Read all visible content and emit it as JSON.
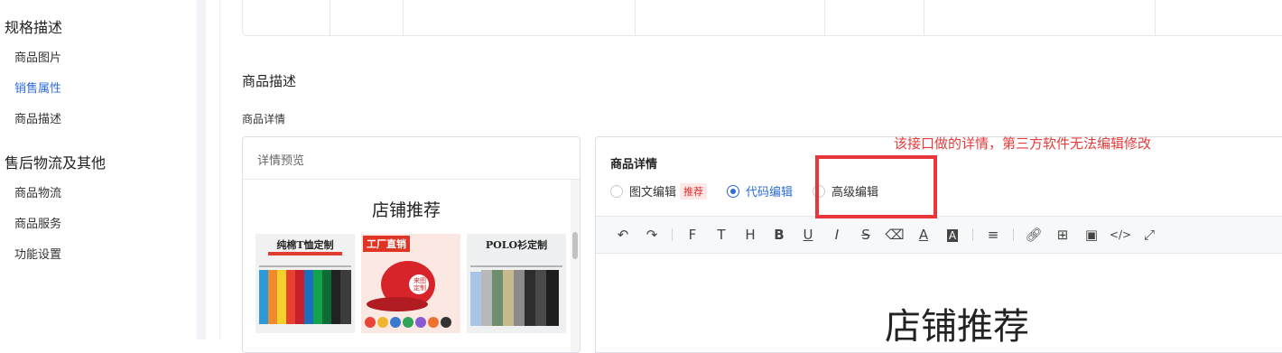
{
  "sidebar": {
    "sections": [
      {
        "title": "规格描述",
        "items": [
          "商品图片",
          "销售属性",
          "商品描述"
        ],
        "active": 1
      },
      {
        "title": "售后物流及其他",
        "items": [
          "商品物流",
          "商品服务",
          "功能设置"
        ]
      }
    ]
  },
  "main": {
    "section_title": "商品描述",
    "sub_title": "商品详情",
    "preview": {
      "header": "详情预览",
      "title": "店铺推荐",
      "products": [
        {
          "banner": "纯棉T恤定制"
        },
        {
          "banner": "工厂直销",
          "sub": "来图定制"
        },
        {
          "banner": "POLO衫定制"
        }
      ]
    },
    "editor": {
      "title": "商品详情",
      "modes": [
        {
          "label": "图文编辑",
          "badge": "推荐",
          "selected": false
        },
        {
          "label": "代码编辑",
          "selected": true
        },
        {
          "label": "高级编辑",
          "selected": false
        }
      ],
      "content_title": "店铺推荐"
    }
  },
  "annotation": {
    "note": "该接口做的详情，第三方软件无法编辑修改"
  },
  "colors": {
    "accent": "#2f6bdc",
    "annotation": "#e8363b"
  }
}
